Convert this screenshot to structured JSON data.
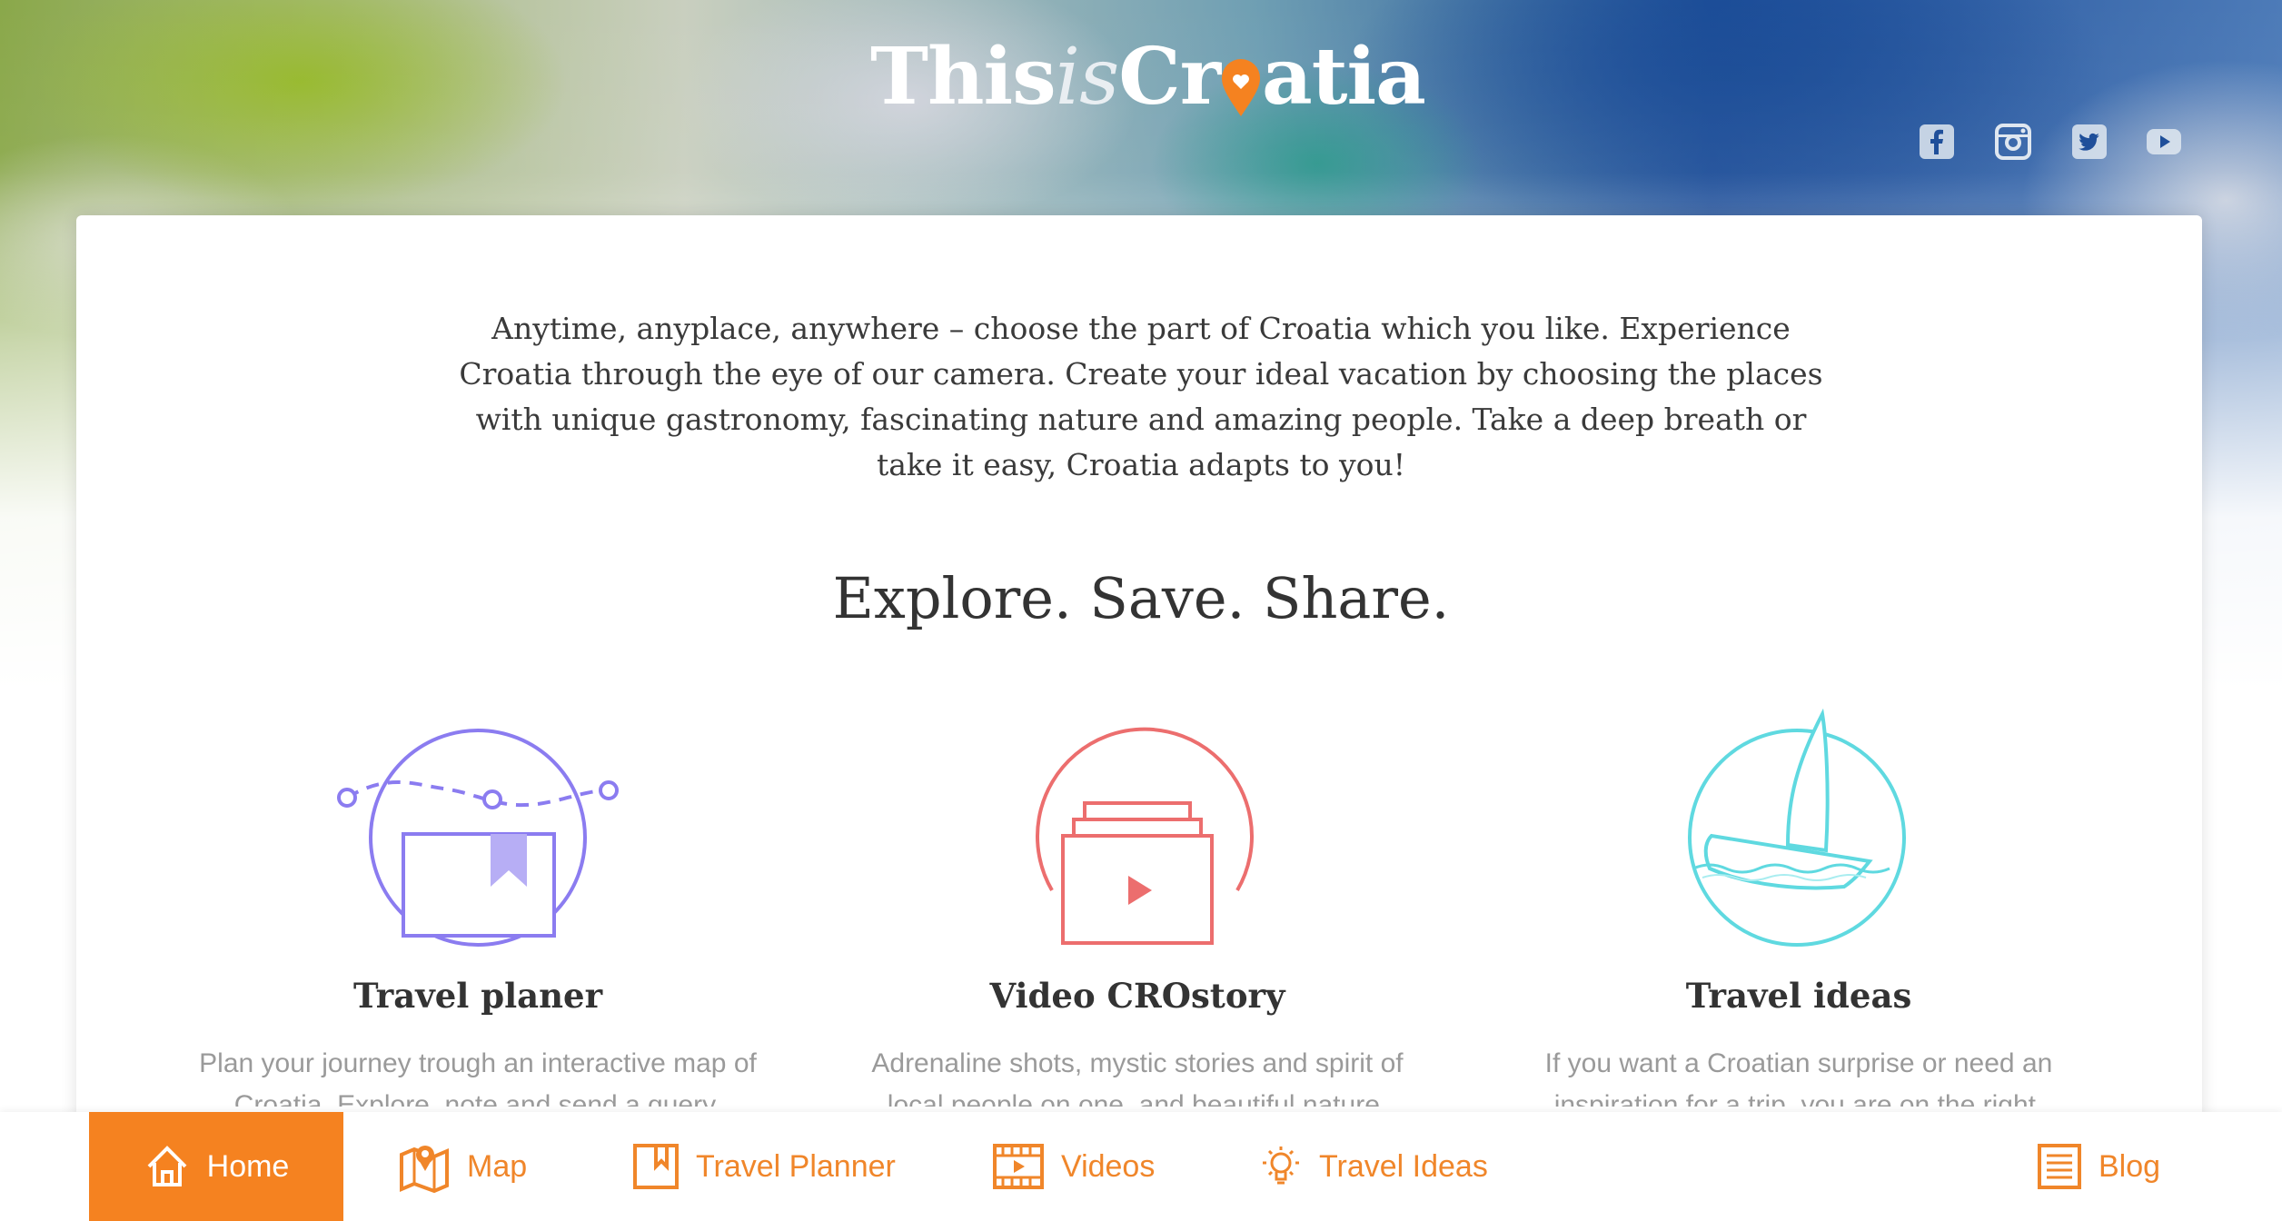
{
  "brand": {
    "logo_part1": "This",
    "logo_part2": "is",
    "logo_part3": "Cr",
    "logo_part4": "atia",
    "accent_color": "#f58220"
  },
  "social": [
    {
      "name": "facebook-icon"
    },
    {
      "name": "instagram-icon"
    },
    {
      "name": "twitter-icon"
    },
    {
      "name": "youtube-icon"
    }
  ],
  "intro": {
    "text": "Anytime, anyplace, anywhere – choose the part of Croatia which you like. Experience Croatia through the eye of our camera. Create your ideal vacation by choosing the places with unique gastronomy, fascinating nature and amazing people. Take a deep breath or take it easy, Croatia adapts to you!"
  },
  "headline": "Explore. Save. Share.",
  "features": [
    {
      "title": "Travel planer",
      "description": "Plan your journey trough an interactive map of Croatia. Explore, note and send a query.",
      "icon": "travel-planner-icon",
      "color": "#8b7cf0"
    },
    {
      "title": "Video CROstory",
      "description": "Adrenaline shots, mystic stories and spirit of local people on one, and beautiful nature.",
      "icon": "video-icon",
      "color": "#ec6e6e"
    },
    {
      "title": "Travel ideas",
      "description": "If you want a Croatian surprise or need an inspiration for a trip, you are on the right.",
      "icon": "sailboat-icon",
      "color": "#5fd9e0"
    }
  ],
  "nav": {
    "home": "Home",
    "map": "Map",
    "travel_planner": "Travel Planner",
    "videos": "Videos",
    "travel_ideas": "Travel Ideas",
    "blog": "Blog",
    "active": "Home"
  }
}
